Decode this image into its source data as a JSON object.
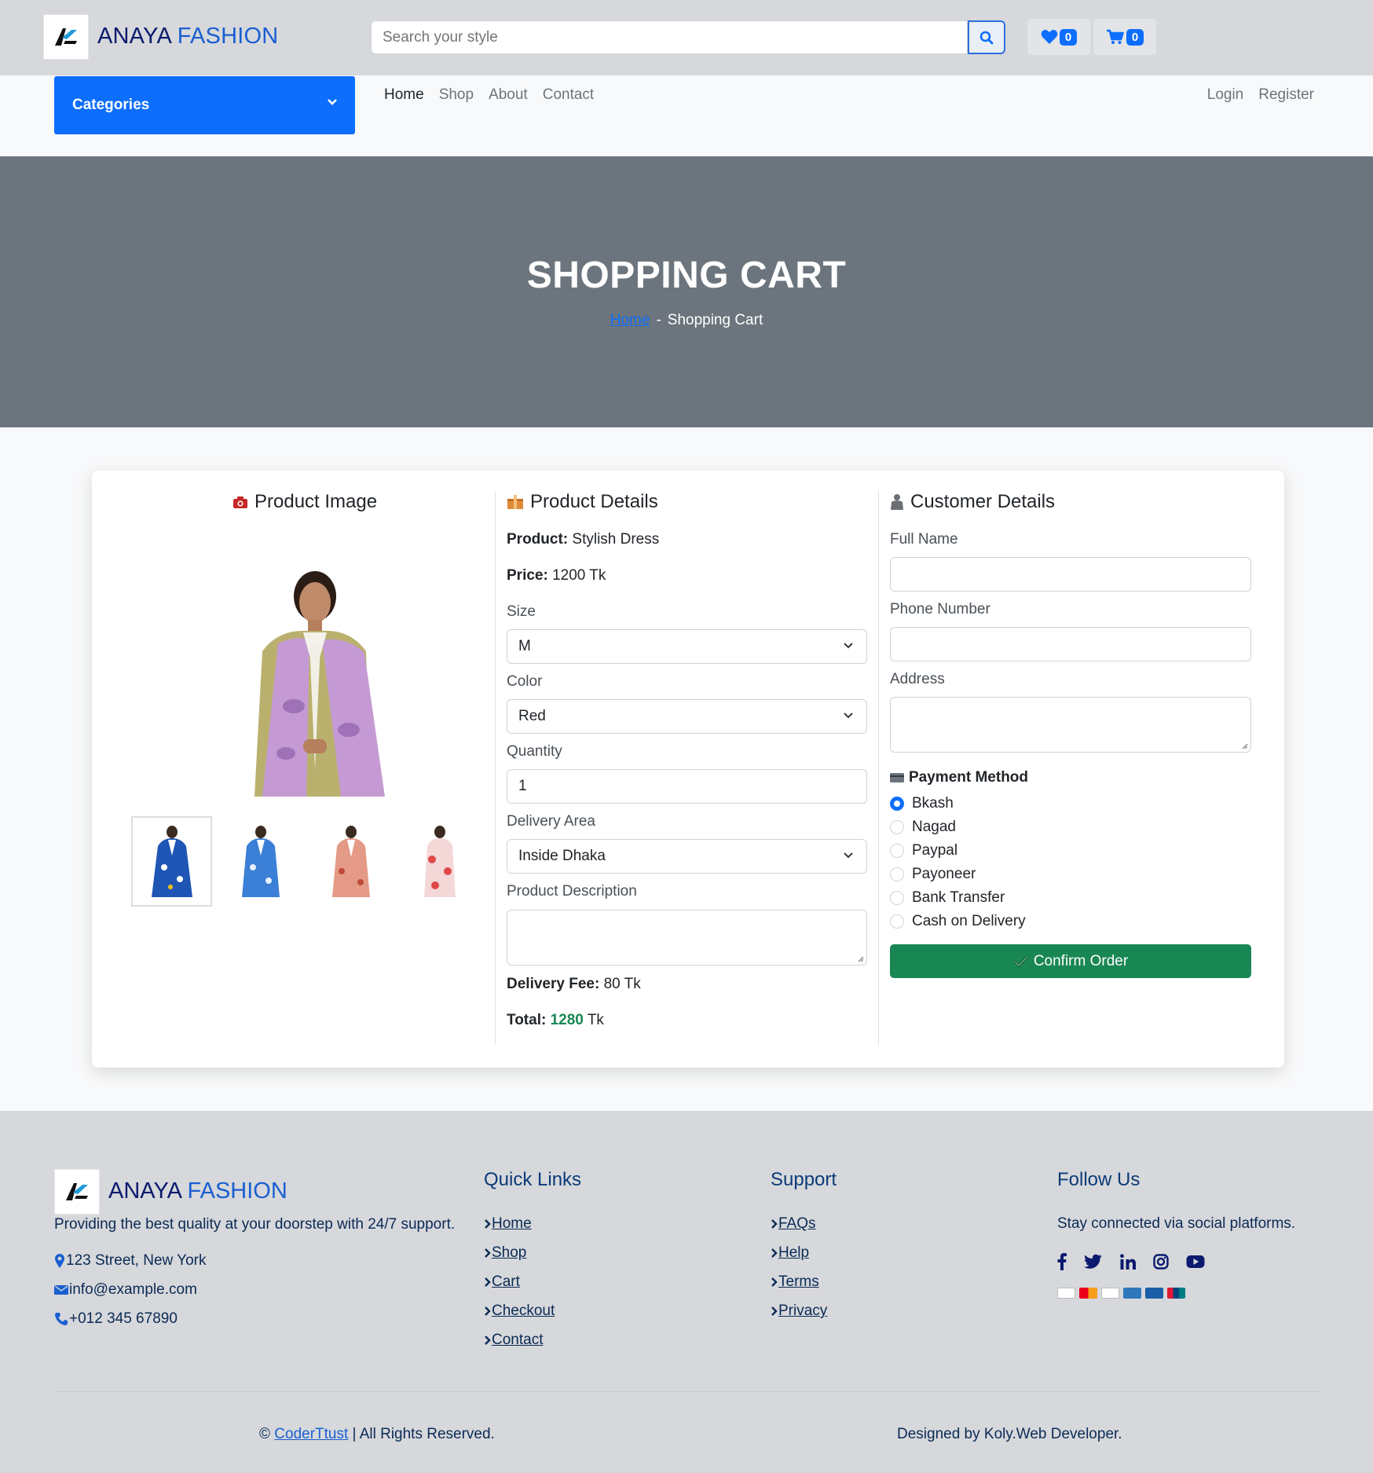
{
  "header": {
    "brand_part1": "ANAYA",
    "brand_part2": "FASHION",
    "search_placeholder": "Search your style",
    "wishlist_count": "0",
    "cart_count": "0"
  },
  "nav": {
    "categories_label": "Categories",
    "links": [
      "Home",
      "Shop",
      "About",
      "Contact"
    ],
    "auth": [
      "Login",
      "Register"
    ]
  },
  "hero": {
    "title": "SHOPPING CART",
    "breadcrumb_home": "Home",
    "breadcrumb_sep": "-",
    "breadcrumb_current": "Shopping Cart"
  },
  "product_image": {
    "heading": "Product Image"
  },
  "product_details": {
    "heading": "Product Details",
    "product_label": "Product:",
    "product_value": "Stylish Dress",
    "price_label": "Price:",
    "price_value": "1200 Tk",
    "size_label": "Size",
    "size_value": "M",
    "color_label": "Color",
    "color_value": "Red",
    "quantity_label": "Quantity",
    "quantity_value": "1",
    "delivery_area_label": "Delivery Area",
    "delivery_area_value": "Inside Dhaka",
    "description_label": "Product Description",
    "delivery_fee_label": "Delivery Fee:",
    "delivery_fee_value": "80 Tk",
    "total_label": "Total:",
    "total_value": "1280",
    "total_unit": "Tk"
  },
  "customer_details": {
    "heading": "Customer Details",
    "full_name_label": "Full Name",
    "phone_label": "Phone Number",
    "address_label": "Address",
    "payment_heading": "Payment Method",
    "payment_options": [
      "Bkash",
      "Nagad",
      "Paypal",
      "Payoneer",
      "Bank Transfer",
      "Cash on Delivery"
    ],
    "selected_payment": "Bkash",
    "confirm_label": "Confirm Order"
  },
  "footer": {
    "brand_part1": "ANAYA",
    "brand_part2": "FASHION",
    "tagline": "Providing the best quality at your doorstep with 24/7 support.",
    "address": "123 Street, New York",
    "email": "info@example.com",
    "phone": "+012 345 67890",
    "quick_links_heading": "Quick Links",
    "quick_links": [
      "Home",
      "Shop",
      "Cart",
      "Checkout",
      "Contact"
    ],
    "support_heading": "Support",
    "support_links": [
      "FAQs",
      "Help",
      "Terms",
      "Privacy"
    ],
    "follow_heading": "Follow Us",
    "follow_text": "Stay connected via social platforms.",
    "copyright_prefix": "©",
    "copyright_link": "CoderTtust",
    "copyright_suffix": "| All Rights Reserved.",
    "designed_by": "Designed by Koly.Web Developer."
  },
  "colors": {
    "primary": "#0d6efd",
    "success": "#198754",
    "hero_bg": "#6c757d",
    "header_bg": "#d6d8db",
    "brand_dark": "#0b1a6e",
    "brand_blue": "#1a5fd1"
  },
  "icons": [
    "logo-icon",
    "search-icon",
    "heart-icon",
    "cart-icon",
    "chevron-down-icon",
    "camera-icon",
    "box-icon",
    "user-icon",
    "credit-card-icon",
    "check-icon",
    "map-pin-icon",
    "envelope-icon",
    "phone-icon",
    "facebook-icon",
    "twitter-icon",
    "linkedin-icon",
    "instagram-icon",
    "youtube-icon"
  ]
}
